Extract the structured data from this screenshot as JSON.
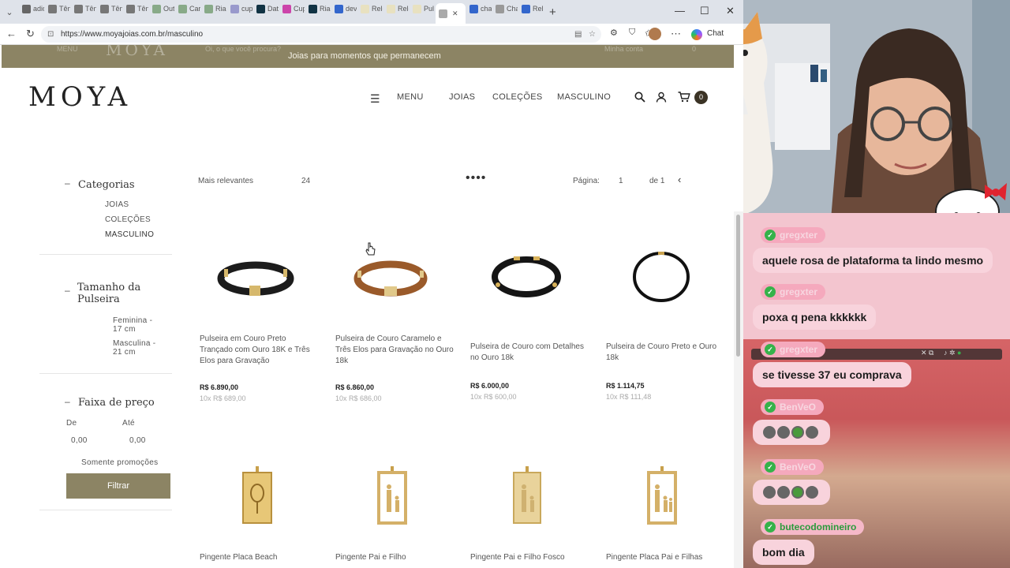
{
  "browser": {
    "url": "https://www.moyajoias.com.br/masculino",
    "tabs": [
      "adid",
      "Tên",
      "Tên",
      "Tên",
      "Tên",
      "Out",
      "Car",
      "Riac",
      "cup",
      "Dat",
      "Cup",
      "Riac",
      "dev",
      "Relc",
      "Relc",
      "Pul",
      "",
      "cha",
      "Cha",
      "Rel"
    ],
    "copilot_label": "Chat"
  },
  "site": {
    "sticky_tagline": "Joias para momentos que permanecem",
    "sticky_menu": "MENU",
    "sticky_search_placeholder": "Oi, o que você procura?",
    "sticky_account": "Minha conta",
    "sticky_cart_count": "0",
    "logo": "MOYA",
    "nav": {
      "menu": "MENU",
      "joias": "JOIAS",
      "colecoes": "COLEÇÕES",
      "masculino": "MASCULINO"
    },
    "cart_count": "0",
    "sidebar": {
      "categorias_title": "Categorias",
      "categorias": [
        "JOIAS",
        "COLEÇÕES",
        "MASCULINO"
      ],
      "tamanho_title_1": "Tamanho da",
      "tamanho_title_2": "Pulseira",
      "tamanhos": [
        {
          "l1": "Feminina -",
          "l2": "17 cm"
        },
        {
          "l1": "Masculina -",
          "l2": "21 cm"
        }
      ],
      "preco_title": "Faixa de preço",
      "de_label": "De",
      "ate_label": "Até",
      "de_value": "0,00",
      "ate_value": "0,00",
      "promo_label": "Somente promoções",
      "filter_button": "Filtrar"
    },
    "toolbar": {
      "sort": "Mais relevantes",
      "per_page": "24",
      "pagina_label": "Página:",
      "page": "1",
      "of_label": "de 1"
    },
    "products": [
      {
        "name": "Pulseira em Couro Preto Trançado com Ouro 18K e Três Elos para Gravação",
        "price": "R$ 6.890,00",
        "installments": "10x R$ 689,00"
      },
      {
        "name": "Pulseira de Couro Caramelo e Três Elos para Gravação no Ouro 18k",
        "price": "R$ 6.860,00",
        "installments": "10x R$ 686,00"
      },
      {
        "name": "Pulseira de Couro com Detalhes no Ouro 18k",
        "price": "R$ 6.000,00",
        "installments": "10x R$ 600,00"
      },
      {
        "name": "Pulseira de Couro Preto e Ouro 18k",
        "price": "R$ 1.114,75",
        "installments": "10x R$ 111,48"
      },
      {
        "name": "Pingente Placa Beach"
      },
      {
        "name": "Pingente Pai e Filho"
      },
      {
        "name": "Pingente Pai e Filho Fosco"
      },
      {
        "name": "Pingente Placa Pai e Filhas"
      }
    ]
  },
  "chat": [
    {
      "user": "gregxter",
      "text": "aquele rosa de plataforma ta lindo mesmo"
    },
    {
      "user": "gregxter",
      "text": "poxa q pena kkkkkk"
    },
    {
      "user": "gregxter",
      "text": "se tivesse 37 eu comprava"
    },
    {
      "user": "BenVeO",
      "text": ""
    },
    {
      "user": "BenVeO",
      "text": ""
    },
    {
      "user": "butecodomineiro",
      "text": "bom dia"
    }
  ],
  "colors": {
    "brand": "#8c8464",
    "chat_bg": "#f3c5cf",
    "chat_bubble": "#f8d3dc",
    "verified": "#36b24a"
  }
}
